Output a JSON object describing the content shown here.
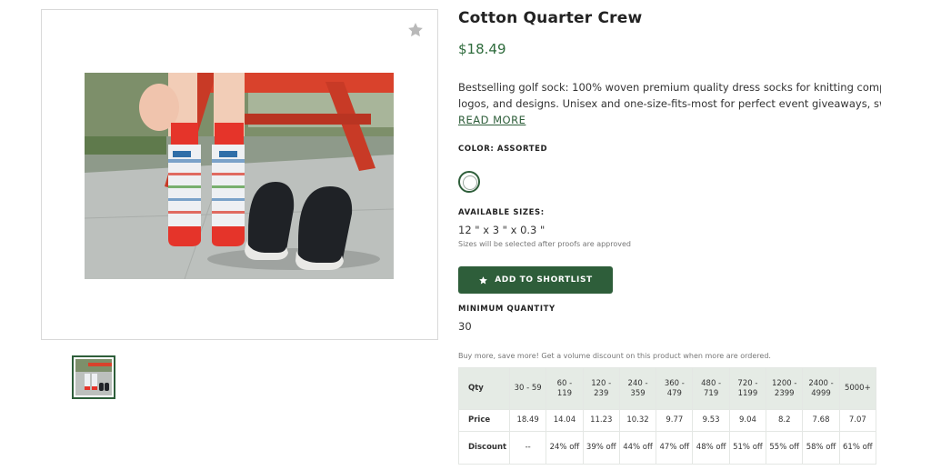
{
  "product": {
    "title": "Cotton Quarter Crew",
    "price": "$18.49",
    "description_line1": "Bestselling golf sock: 100% woven premium quality dress socks for knitting complex",
    "description_line2": "logos, and designs. Unisex and one-size-fits-most for perfect event giveaways, swa...",
    "read_more": "READ MORE"
  },
  "color": {
    "label": "COLOR: ASSORTED"
  },
  "sizes": {
    "label": "AVAILABLE SIZES:",
    "value": "12 \" x 3 \" x 0.3 \"",
    "note": "Sizes will be selected after proofs are approved"
  },
  "actions": {
    "shortlist_label": "ADD TO SHORTLIST"
  },
  "minimum": {
    "label": "MINIMUM QUANTITY",
    "value": "30"
  },
  "pricing": {
    "note": "Buy more, save more! Get a volume discount on this product when more are ordered.",
    "qty_label": "Qty",
    "price_label": "Price",
    "discount_label": "Discount",
    "tiers": [
      {
        "qty": "30 - 59",
        "price": "18.49",
        "discount": "--"
      },
      {
        "qty": "60 - 119",
        "price": "14.04",
        "discount": "24% off"
      },
      {
        "qty": "120 - 239",
        "price": "11.23",
        "discount": "39% off"
      },
      {
        "qty": "240 - 359",
        "price": "10.32",
        "discount": "44% off"
      },
      {
        "qty": "360 - 479",
        "price": "9.77",
        "discount": "47% off"
      },
      {
        "qty": "480 - 719",
        "price": "9.53",
        "discount": "48% off"
      },
      {
        "qty": "720 - 1199",
        "price": "9.04",
        "discount": "51% off"
      },
      {
        "qty": "1200 - 2399",
        "price": "8.2",
        "discount": "55% off"
      },
      {
        "qty": "2400 - 4999",
        "price": "7.68",
        "discount": "58% off"
      },
      {
        "qty": "5000+",
        "price": "7.07",
        "discount": "61% off"
      }
    ]
  },
  "icons": {
    "favorite": "star-icon",
    "shortlist": "star-icon"
  },
  "colors": {
    "brand_green": "#2e5e3a",
    "price_green": "#2e6b3c",
    "table_header_bg": "#e5ebe5"
  }
}
